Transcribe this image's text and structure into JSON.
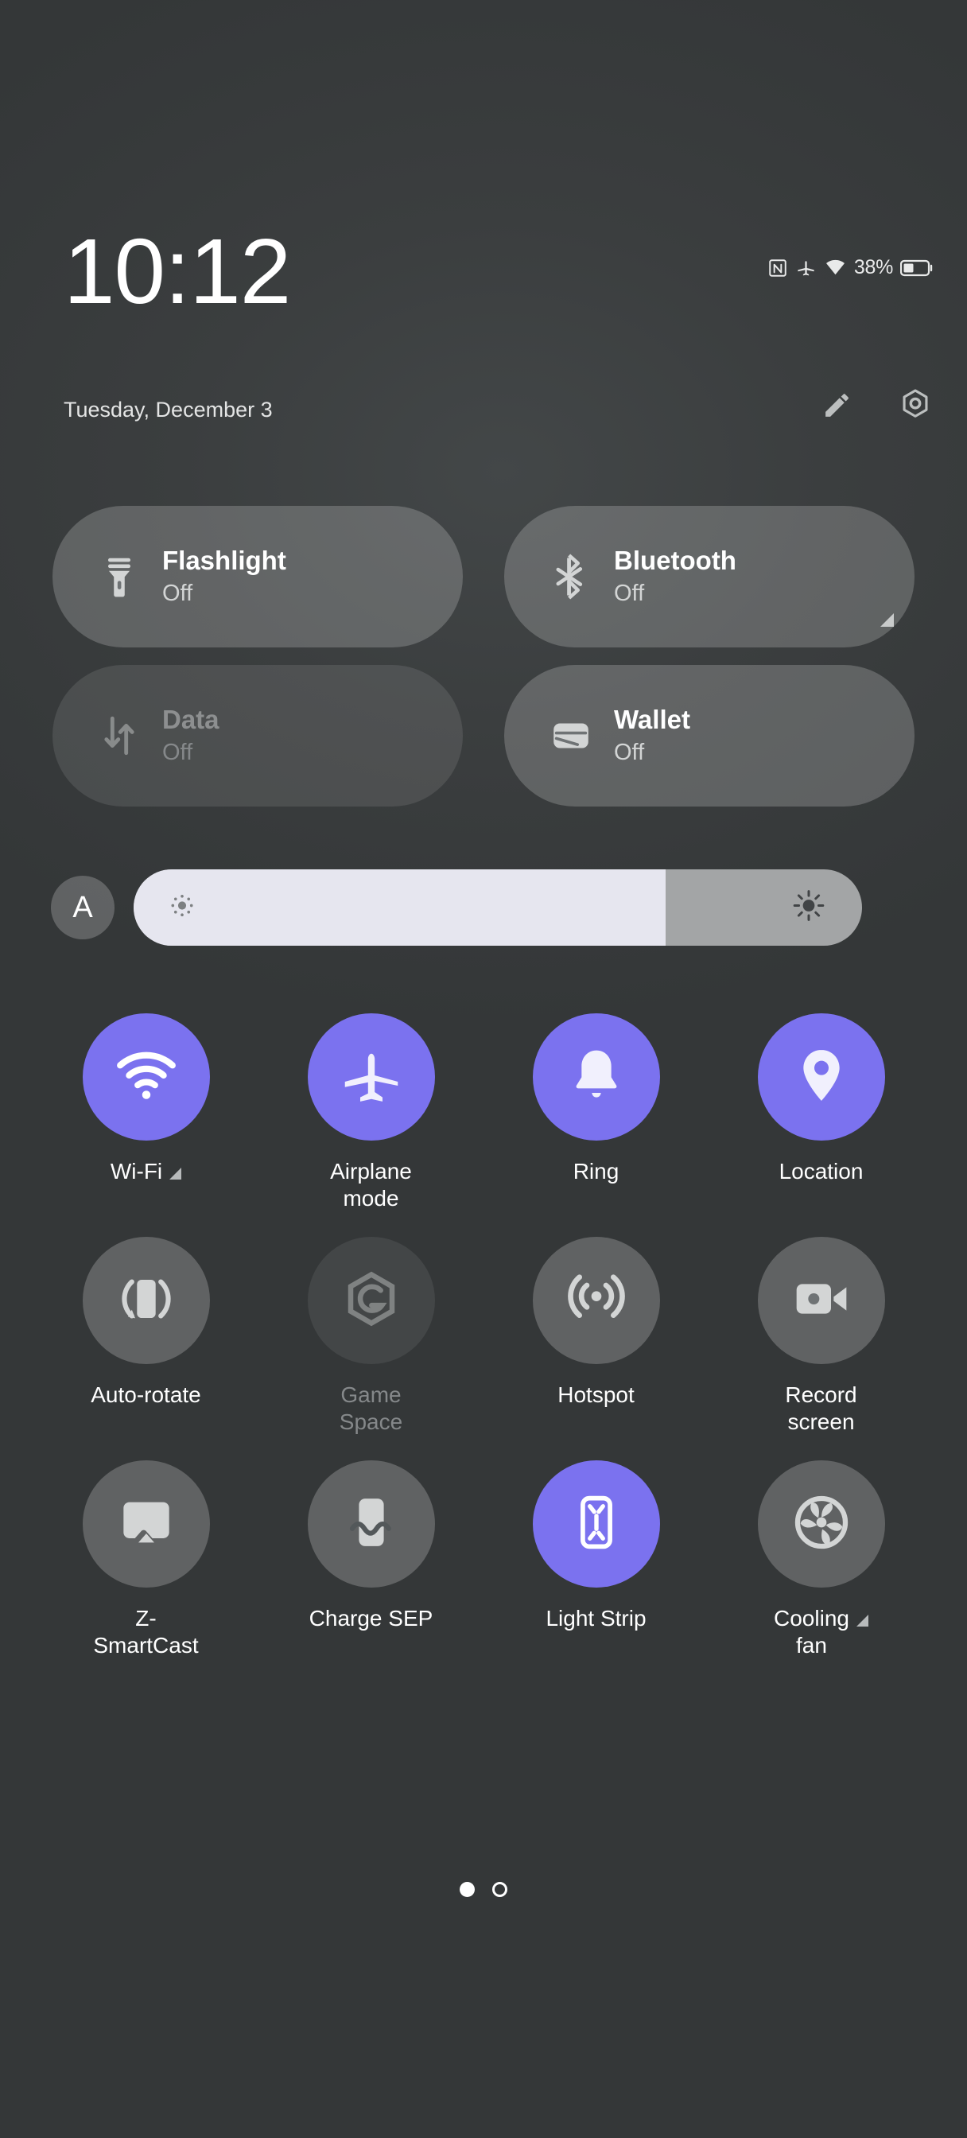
{
  "theme": {
    "background": "#3a3d3e",
    "accent": "#7b72ef",
    "tile_bg": "rgba(255,255,255,0.20)",
    "slider_fill": "#e6e6ef",
    "slider_track": "#a3a5a6",
    "text_primary": "#ffffff",
    "text_secondary": "#d3d5d5",
    "text_disabled": "#85888a"
  },
  "header": {
    "time": "10:12",
    "date": "Tuesday, December 3",
    "battery_percent": "38%",
    "status_icons": [
      "nfc-icon",
      "airplane-icon",
      "wifi-icon",
      "battery-icon"
    ],
    "actions": [
      {
        "name": "edit-button",
        "icon": "pencil-icon"
      },
      {
        "name": "settings-button",
        "icon": "gear-icon"
      }
    ]
  },
  "tiles": [
    {
      "name": "flashlight",
      "icon": "flashlight-icon",
      "title": "Flashlight",
      "status": "Off",
      "state": "enabled",
      "expandable": false
    },
    {
      "name": "bluetooth",
      "icon": "bluetooth-icon",
      "title": "Bluetooth",
      "status": "Off",
      "state": "enabled",
      "expandable": true
    },
    {
      "name": "data",
      "icon": "data-icon",
      "title": "Data",
      "status": "Off",
      "state": "disabled",
      "expandable": false
    },
    {
      "name": "wallet",
      "icon": "wallet-icon",
      "title": "Wallet",
      "status": "Off",
      "state": "enabled",
      "expandable": false
    }
  ],
  "brightness": {
    "auto_label": "A",
    "auto_icon": "auto-brightness-icon",
    "level_percent": 73,
    "low_icon": "brightness-low-icon",
    "high_icon": "brightness-high-icon"
  },
  "toggles": [
    {
      "name": "wifi",
      "icon": "wifi-icon",
      "label": "Wi-Fi",
      "state": "on",
      "expandable": true
    },
    {
      "name": "airplane",
      "icon": "airplane-icon",
      "label": "Airplane\nmode",
      "state": "on",
      "expandable": false
    },
    {
      "name": "ring",
      "icon": "bell-icon",
      "label": "Ring",
      "state": "on",
      "expandable": false
    },
    {
      "name": "location",
      "icon": "location-pin-icon",
      "label": "Location",
      "state": "on",
      "expandable": false
    },
    {
      "name": "auto-rotate",
      "icon": "auto-rotate-icon",
      "label": "Auto-rotate",
      "state": "off",
      "expandable": false
    },
    {
      "name": "game-space",
      "icon": "game-space-icon",
      "label": "Game\nSpace",
      "state": "disabled",
      "expandable": false
    },
    {
      "name": "hotspot",
      "icon": "hotspot-icon",
      "label": "Hotspot",
      "state": "off",
      "expandable": false
    },
    {
      "name": "record-screen",
      "icon": "video-camera-icon",
      "label": "Record\nscreen",
      "state": "off",
      "expandable": false
    },
    {
      "name": "smartcast",
      "icon": "cast-icon",
      "label": "Z-\nSmartCast",
      "state": "off",
      "expandable": false
    },
    {
      "name": "charge-sep",
      "icon": "charge-sep-icon",
      "label": "Charge SEP",
      "state": "off",
      "expandable": false
    },
    {
      "name": "light-strip",
      "icon": "light-strip-icon",
      "label": "Light Strip",
      "state": "on",
      "expandable": false
    },
    {
      "name": "cooling-fan",
      "icon": "fan-icon",
      "label": "Cooling\nfan",
      "state": "off",
      "expandable": true
    }
  ],
  "pager": {
    "total": 2,
    "active_index": 0
  }
}
